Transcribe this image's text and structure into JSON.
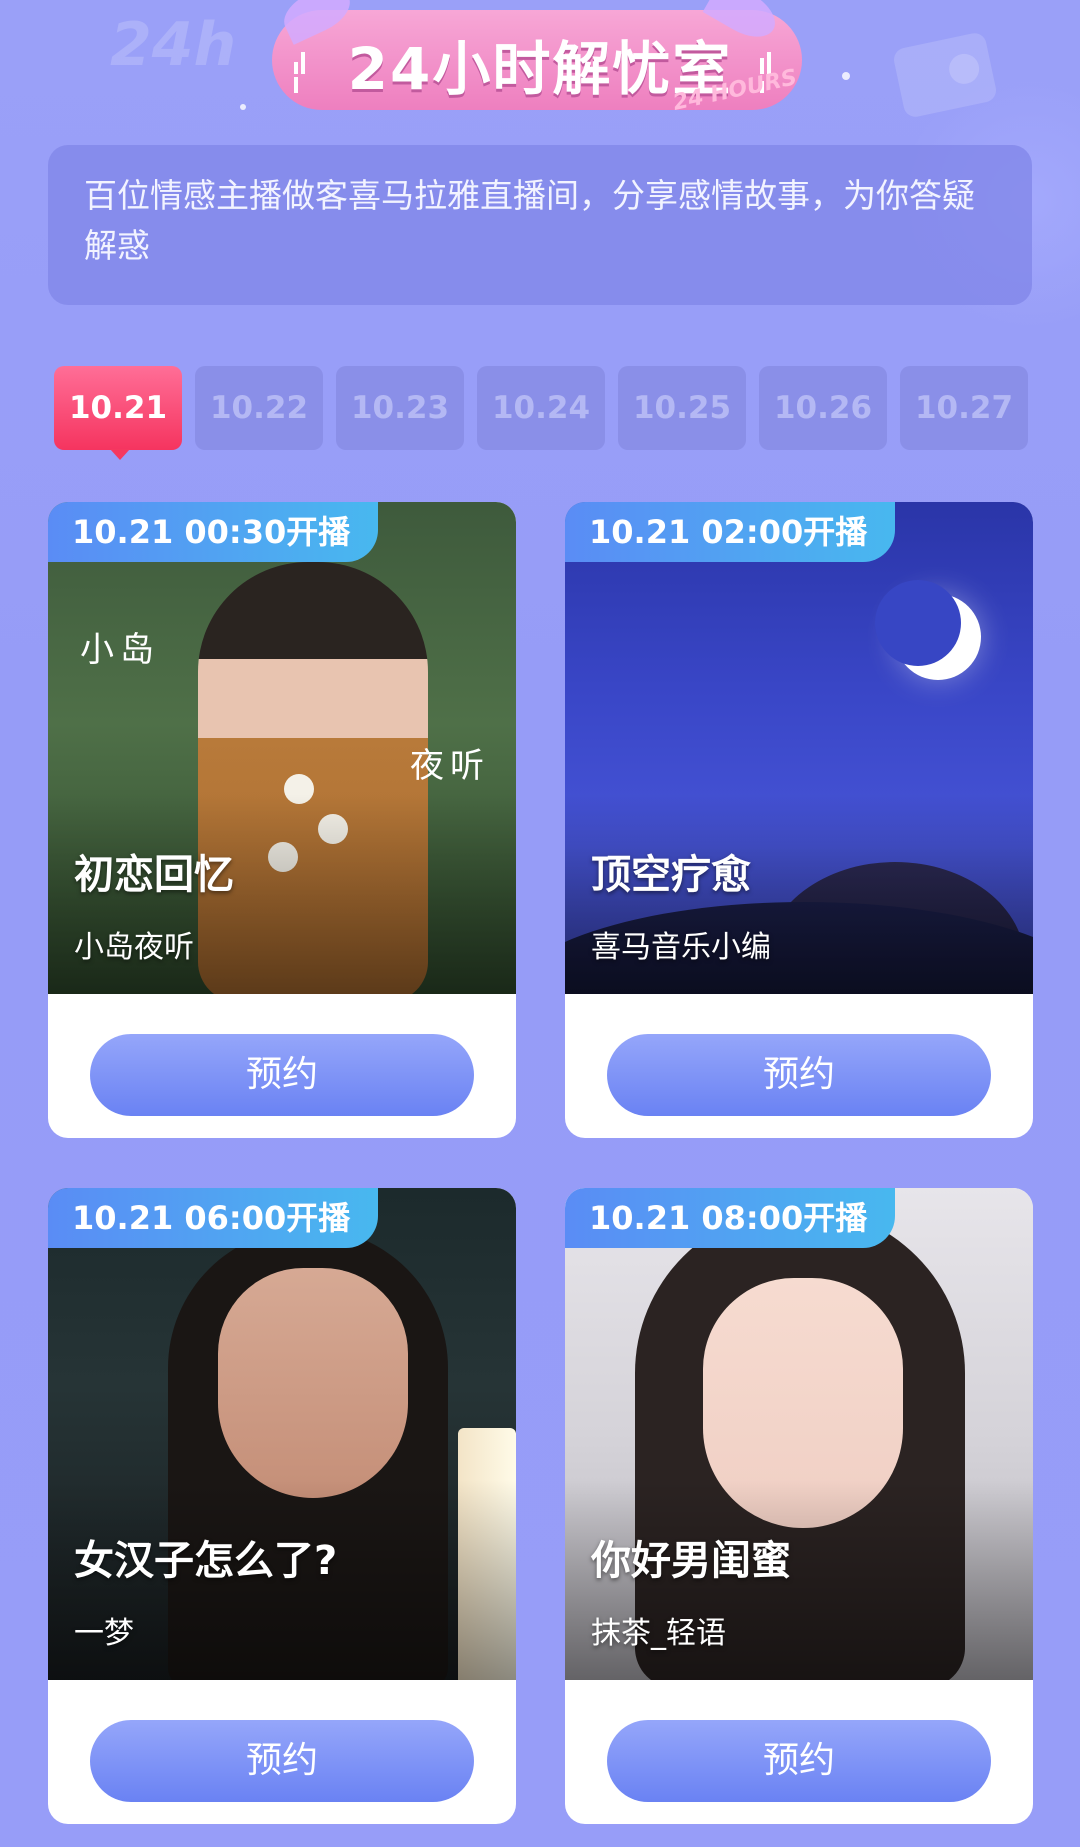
{
  "header": {
    "title": "24小时解忧室",
    "subtitle": "24 HOURS"
  },
  "description": "百位情感主播做客喜马拉雅直播间，分享感情故事，为你答疑解惑",
  "date_tabs": [
    {
      "label": "10.21",
      "active": true
    },
    {
      "label": "10.22",
      "active": false
    },
    {
      "label": "10.23",
      "active": false
    },
    {
      "label": "10.24",
      "active": false
    },
    {
      "label": "10.25",
      "active": false
    },
    {
      "label": "10.26",
      "active": false
    },
    {
      "label": "10.27",
      "active": false
    }
  ],
  "cards": [
    {
      "time": "10.21 00:30开播",
      "title": "初恋回忆",
      "host": "小岛夜听",
      "image_text": [
        "小岛",
        "夜听"
      ],
      "button": "预约"
    },
    {
      "time": "10.21 02:00开播",
      "title": "顶空疗愈",
      "host": "喜马音乐小编",
      "button": "预约"
    },
    {
      "time": "10.21 06:00开播",
      "title": "女汉子怎么了?",
      "host": "一梦",
      "button": "预约"
    },
    {
      "time": "10.21 08:00开播",
      "title": "你好男闺蜜",
      "host": "抹茶_轻语",
      "button": "预约"
    }
  ],
  "colors": {
    "background": "#969cf7",
    "active_tab": "#f5345f",
    "badge": "#5a8cf5",
    "button": "#7c91f6"
  }
}
